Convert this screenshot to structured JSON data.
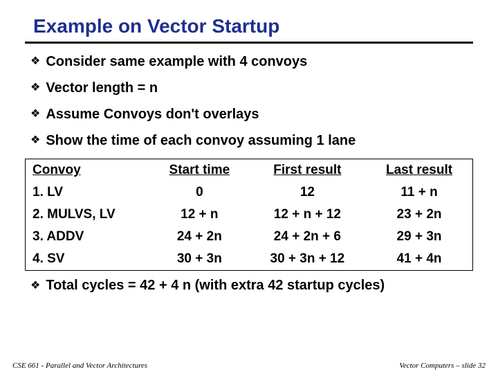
{
  "title": "Example on Vector Startup",
  "bullets": [
    "Consider same example with 4 convoys",
    "Vector length = n",
    "Assume Convoys don't overlays",
    "Show the time of each convoy assuming 1 lane"
  ],
  "table": {
    "headers": [
      "Convoy",
      "Start time",
      "First result",
      "Last result"
    ],
    "rows": [
      [
        "1. LV",
        "0",
        "12",
        "11 + n"
      ],
      [
        "2. MULVS, LV",
        "12 + n",
        "12 + n + 12",
        "23 + 2n"
      ],
      [
        "3. ADDV",
        "24 + 2n",
        "24 + 2n + 6",
        "29 + 3n"
      ],
      [
        "4. SV",
        "30 + 3n",
        "30 + 3n + 12",
        "41 + 4n"
      ]
    ]
  },
  "summary": "Total cycles = 42 + 4 n (with extra 42 startup cycles)",
  "footer": {
    "left": "CSE 661 - Parallel and Vector Architectures",
    "right": "Vector Computers – slide 32"
  },
  "glyph": {
    "diamond": "❖"
  }
}
